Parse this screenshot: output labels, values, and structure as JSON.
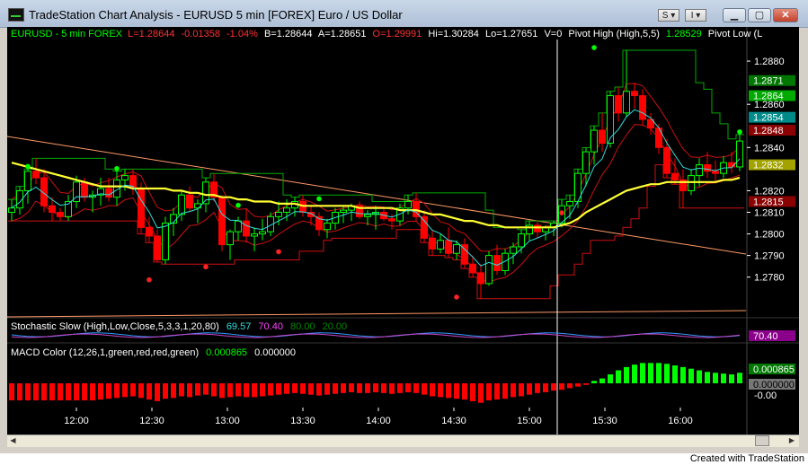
{
  "window": {
    "title": "TradeStation Chart Analysis - EURUSD  5 min  [FOREX] Euro / US Dollar",
    "s_button": "S",
    "i_button": "I",
    "footer": "Created with TradeStation"
  },
  "colors": {
    "background": "#000000",
    "up_candle": "#00ff00",
    "down_candle": "#ff0000",
    "ma_slow": "#ffff33",
    "ma_fast": "#33dddd",
    "channel": "#00aa00",
    "envelope": "#cc1111",
    "trendline": "#ff9966",
    "macd_pos": "#00ff00",
    "macd_neg": "#ff0000"
  },
  "chart_data": [
    {
      "type": "line",
      "panel": "price",
      "legend": {
        "symbol": "EURUSD - 5 min  FOREX",
        "last": "L=1.28644",
        "change": "-0.01358",
        "change_pct": "-1.04%",
        "bid": "B=1.28644",
        "ask": "A=1.28651",
        "open": "O=1.29991",
        "high": "Hi=1.30284",
        "low": "Lo=1.27651",
        "volume": "V=0",
        "pivot_high": "Pivot High (High,5,5)",
        "pivot_value": "1.28529",
        "pivot_low": "Pivot Low  (L"
      },
      "ylim": [
        1.2762,
        1.289
      ],
      "y_ticks": [
        "1.2880",
        "1.2860",
        "1.2840",
        "1.2820",
        "1.2810",
        "1.2800",
        "1.2790",
        "1.2780"
      ],
      "y_markers": [
        {
          "label": "1.2871",
          "value": 1.2871,
          "color": "#007700"
        },
        {
          "label": "1.2864",
          "value": 1.2864,
          "color": "#00aa00"
        },
        {
          "label": "1.2854",
          "value": 1.2854,
          "color": "#008b8b"
        },
        {
          "label": "1.2848",
          "value": 1.2848,
          "color": "#8b0000"
        },
        {
          "label": "1.2832",
          "value": 1.2832,
          "color": "#a3a300"
        },
        {
          "label": "1.2815",
          "value": 1.2815,
          "color": "#8b0000"
        }
      ],
      "x_labels": [
        "12:00",
        "12:30",
        "13:00",
        "13:30",
        "14:00",
        "14:30",
        "15:00",
        "15:30",
        "16:00"
      ],
      "cursor_after_bar": 67,
      "ohlc": [
        [
          1.281,
          1.2816,
          1.2806,
          1.2812
        ],
        [
          1.2812,
          1.2822,
          1.2809,
          1.282
        ],
        [
          1.282,
          1.283,
          1.2814,
          1.2829
        ],
        [
          1.2829,
          1.2835,
          1.2823,
          1.2826
        ],
        [
          1.2826,
          1.283,
          1.281,
          1.2813
        ],
        [
          1.2813,
          1.2817,
          1.2806,
          1.281
        ],
        [
          1.281,
          1.2812,
          1.2806,
          1.2808
        ],
        [
          1.2808,
          1.2818,
          1.2806,
          1.2815
        ],
        [
          1.2815,
          1.2827,
          1.2812,
          1.2824
        ],
        [
          1.2824,
          1.2826,
          1.2815,
          1.2817
        ],
        [
          1.2817,
          1.282,
          1.281,
          1.2818
        ],
        [
          1.2818,
          1.2826,
          1.2813,
          1.2821
        ],
        [
          1.2821,
          1.2826,
          1.2815,
          1.2817
        ],
        [
          1.2817,
          1.2829,
          1.2813,
          1.2825
        ],
        [
          1.2825,
          1.283,
          1.282,
          1.2827
        ],
        [
          1.2827,
          1.283,
          1.2818,
          1.2821
        ],
        [
          1.2821,
          1.2824,
          1.28,
          1.2803
        ],
        [
          1.2803,
          1.2808,
          1.2796,
          1.2799
        ],
        [
          1.2799,
          1.2802,
          1.2787,
          1.2788
        ],
        [
          1.2788,
          1.2808,
          1.2786,
          1.2805
        ],
        [
          1.2805,
          1.2812,
          1.2799,
          1.2809
        ],
        [
          1.2809,
          1.282,
          1.2806,
          1.2818
        ],
        [
          1.2818,
          1.2822,
          1.281,
          1.2812
        ],
        [
          1.2812,
          1.2816,
          1.2805,
          1.2814
        ],
        [
          1.2814,
          1.2826,
          1.281,
          1.2824
        ],
        [
          1.2824,
          1.2828,
          1.2815,
          1.2817
        ],
        [
          1.2817,
          1.2818,
          1.2792,
          1.2795
        ],
        [
          1.2795,
          1.2802,
          1.2788,
          1.2801
        ],
        [
          1.2801,
          1.2808,
          1.2797,
          1.2806
        ],
        [
          1.2806,
          1.2812,
          1.2796,
          1.2799
        ],
        [
          1.2799,
          1.2803,
          1.2792,
          1.28
        ],
        [
          1.28,
          1.2807,
          1.2797,
          1.2801
        ],
        [
          1.2801,
          1.281,
          1.2799,
          1.2808
        ],
        [
          1.2808,
          1.2815,
          1.2804,
          1.281
        ],
        [
          1.281,
          1.2816,
          1.2806,
          1.2812
        ],
        [
          1.2812,
          1.2817,
          1.2808,
          1.2815
        ],
        [
          1.2815,
          1.2818,
          1.2808,
          1.281
        ],
        [
          1.281,
          1.2813,
          1.2804,
          1.2808
        ],
        [
          1.2808,
          1.281,
          1.2799,
          1.2802
        ],
        [
          1.2802,
          1.2807,
          1.2798,
          1.2805
        ],
        [
          1.2805,
          1.2812,
          1.2802,
          1.281
        ],
        [
          1.281,
          1.2813,
          1.2805,
          1.2811
        ],
        [
          1.2811,
          1.2814,
          1.2806,
          1.2813
        ],
        [
          1.2813,
          1.2815,
          1.2807,
          1.2808
        ],
        [
          1.2808,
          1.2811,
          1.2804,
          1.2809
        ],
        [
          1.2809,
          1.2813,
          1.2802,
          1.281
        ],
        [
          1.281,
          1.2812,
          1.2806,
          1.2807
        ],
        [
          1.2807,
          1.2809,
          1.2802,
          1.2806
        ],
        [
          1.2806,
          1.2814,
          1.2804,
          1.2812
        ],
        [
          1.2812,
          1.2818,
          1.2809,
          1.2815
        ],
        [
          1.2815,
          1.2819,
          1.2806,
          1.2808
        ],
        [
          1.2808,
          1.2811,
          1.2796,
          1.2798
        ],
        [
          1.2798,
          1.2802,
          1.279,
          1.2793
        ],
        [
          1.2793,
          1.28,
          1.2791,
          1.2797
        ],
        [
          1.2797,
          1.2803,
          1.2789,
          1.2791
        ],
        [
          1.2791,
          1.2797,
          1.2788,
          1.2795
        ],
        [
          1.2795,
          1.2798,
          1.2784,
          1.2786
        ],
        [
          1.2786,
          1.279,
          1.278,
          1.2782
        ],
        [
          1.2782,
          1.2786,
          1.277,
          1.2777
        ],
        [
          1.2777,
          1.2792,
          1.2776,
          1.279
        ],
        [
          1.279,
          1.2795,
          1.2781,
          1.2783
        ],
        [
          1.2783,
          1.2793,
          1.2781,
          1.2791
        ],
        [
          1.2791,
          1.2796,
          1.2786,
          1.2794
        ],
        [
          1.2794,
          1.2802,
          1.2791,
          1.28
        ],
        [
          1.28,
          1.2806,
          1.2797,
          1.2804
        ],
        [
          1.2804,
          1.2806,
          1.2798,
          1.2801
        ],
        [
          1.2801,
          1.2804,
          1.2797,
          1.2803
        ],
        [
          1.2803,
          1.2806,
          1.2799,
          1.2805
        ],
        [
          1.2805,
          1.2816,
          1.2803,
          1.2813
        ],
        [
          1.2813,
          1.2818,
          1.2807,
          1.2815
        ],
        [
          1.2815,
          1.283,
          1.2812,
          1.2828
        ],
        [
          1.2828,
          1.284,
          1.2822,
          1.2838
        ],
        [
          1.2838,
          1.285,
          1.2832,
          1.2848
        ],
        [
          1.2848,
          1.2856,
          1.2838,
          1.2842
        ],
        [
          1.2842,
          1.2866,
          1.284,
          1.2864
        ],
        [
          1.2864,
          1.2868,
          1.2852,
          1.2856
        ],
        [
          1.2856,
          1.2885,
          1.2854,
          1.2866
        ],
        [
          1.2866,
          1.287,
          1.2858,
          1.2864
        ],
        [
          1.2864,
          1.2867,
          1.285,
          1.2853
        ],
        [
          1.2853,
          1.2856,
          1.2846,
          1.2849
        ],
        [
          1.2849,
          1.2851,
          1.2837,
          1.284
        ],
        [
          1.284,
          1.2844,
          1.2826,
          1.2828
        ],
        [
          1.2828,
          1.2835,
          1.2823,
          1.2825
        ],
        [
          1.2825,
          1.283,
          1.2812,
          1.282
        ],
        [
          1.282,
          1.283,
          1.2818,
          1.2827
        ],
        [
          1.2827,
          1.2835,
          1.2822,
          1.2832
        ],
        [
          1.2832,
          1.2838,
          1.2826,
          1.2829
        ],
        [
          1.2829,
          1.2834,
          1.2824,
          1.2828
        ],
        [
          1.2828,
          1.2836,
          1.2826,
          1.2833
        ],
        [
          1.2833,
          1.2838,
          1.2828,
          1.2831
        ],
        [
          1.2831,
          1.2846,
          1.2829,
          1.2843
        ]
      ],
      "ma_slow": [
        1.2833,
        1.2832,
        1.2831,
        1.283,
        1.2829,
        1.2828,
        1.2827,
        1.2826,
        1.2825,
        1.2824,
        1.2823,
        1.2822,
        1.2822,
        1.2822,
        1.2822,
        1.2821,
        1.2821,
        1.2821,
        1.2821,
        1.2821,
        1.282,
        1.282,
        1.2819,
        1.2819,
        1.2818,
        1.2818,
        1.2817,
        1.2817,
        1.2816,
        1.2816,
        1.2815,
        1.2815,
        1.2815,
        1.2814,
        1.2814,
        1.2814,
        1.2813,
        1.2813,
        1.2813,
        1.2813,
        1.2813,
        1.2813,
        1.2813,
        1.2812,
        1.2812,
        1.2812,
        1.2812,
        1.2812,
        1.2811,
        1.2811,
        1.2811,
        1.281,
        1.2809,
        1.2809,
        1.2808,
        1.2807,
        1.2806,
        1.2806,
        1.2805,
        1.2804,
        1.2804,
        1.2803,
        1.2803,
        1.2803,
        1.2803,
        1.2803,
        1.2803,
        1.2803,
        1.2804,
        1.2805,
        1.2807,
        1.281,
        1.2812,
        1.2814,
        1.2816,
        1.2818,
        1.282,
        1.2821,
        1.2822,
        1.2823,
        1.2823,
        1.2824,
        1.2824,
        1.2824,
        1.2824,
        1.2824,
        1.2824,
        1.2824,
        1.2825,
        1.2825,
        1.2826
      ],
      "pivot_highs": [
        [
          2,
          1.283
        ],
        [
          13,
          1.2829
        ],
        [
          28,
          1.2812
        ],
        [
          38,
          1.2815
        ],
        [
          72,
          1.2885
        ],
        [
          90,
          1.2846
        ]
      ],
      "pivot_lows": [
        [
          17,
          1.278
        ],
        [
          24,
          1.2786
        ],
        [
          33,
          1.2793
        ],
        [
          55,
          1.2772
        ],
        [
          68,
          1.2811
        ]
      ]
    },
    {
      "type": "line",
      "panel": "stochastic",
      "title": "Stochastic Slow (High,Low,Close,5,3,3,1,20,80)",
      "values": [
        "69.57",
        "70.40",
        "80.00",
        "20.00"
      ],
      "last_label": "70.40"
    },
    {
      "type": "bar",
      "panel": "macd",
      "title": "MACD Color (12,26,1,green,red,red,green)",
      "values_text": [
        "0.000865",
        "0.000000"
      ],
      "axis_labels": [
        "0.000865",
        "0.000000",
        "-0.00"
      ],
      "ylim": [
        -0.0016,
        0.0016
      ],
      "histogram": [
        -0.00105,
        -0.00105,
        -0.00105,
        -0.00105,
        -0.00105,
        -0.00105,
        -0.00105,
        -0.00105,
        -0.00105,
        -0.00105,
        -0.00105,
        -0.001,
        -0.00095,
        -0.0009,
        -0.00085,
        -0.0008,
        -0.0009,
        -0.001,
        -0.0011,
        -0.00095,
        -0.0009,
        -0.0008,
        -0.00085,
        -0.00075,
        -0.0007,
        -0.0008,
        -0.0009,
        -0.00085,
        -0.0008,
        -0.00085,
        -0.00085,
        -0.0008,
        -0.00075,
        -0.0007,
        -0.00065,
        -0.0006,
        -0.00065,
        -0.0007,
        -0.00075,
        -0.0007,
        -0.00065,
        -0.0006,
        -0.00055,
        -0.0006,
        -0.0006,
        -0.00055,
        -0.0006,
        -0.00065,
        -0.0006,
        -0.00055,
        -0.0006,
        -0.0007,
        -0.0008,
        -0.00085,
        -0.0009,
        -0.00095,
        -0.001,
        -0.0011,
        -0.0012,
        -0.00105,
        -0.001,
        -0.00095,
        -0.00085,
        -0.0008,
        -0.0007,
        -0.0006,
        -0.00055,
        -0.00045,
        -0.0004,
        -0.0003,
        -0.0002,
        -0.0001,
        0.00015,
        0.0003,
        0.00055,
        0.0008,
        0.001,
        0.00115,
        0.00125,
        0.00125,
        0.00125,
        0.0012,
        0.0011,
        0.001,
        0.0009,
        0.0008,
        0.0007,
        0.00065,
        0.0006,
        0.00055,
        0.00065
      ]
    }
  ]
}
